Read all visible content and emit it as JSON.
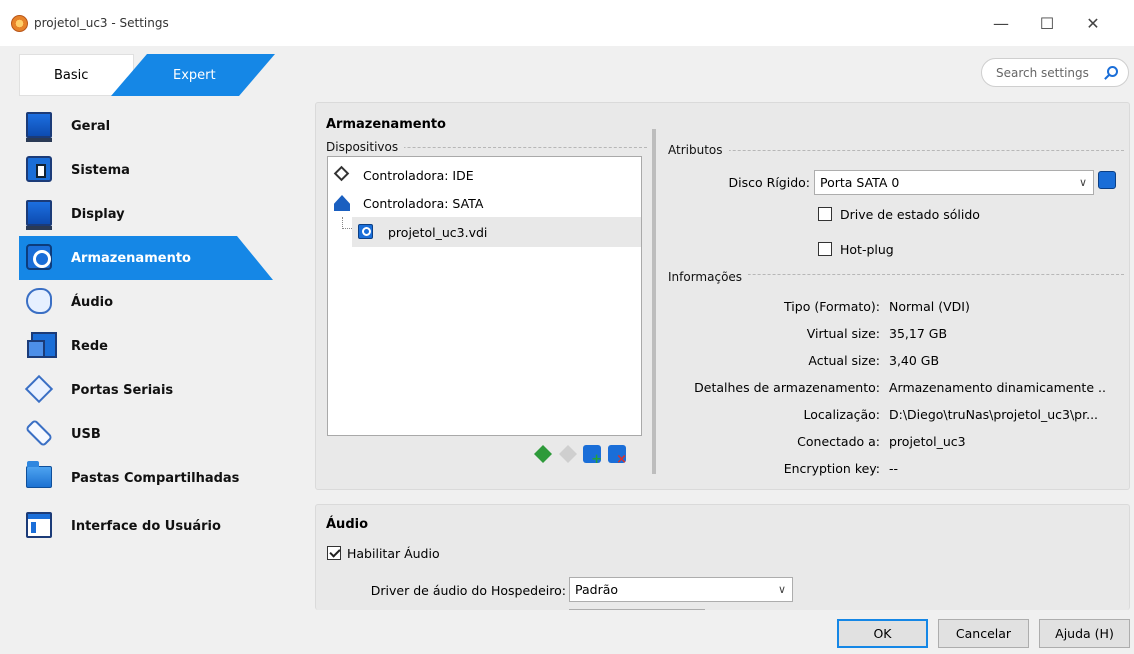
{
  "window": {
    "title": "projetol_uc3 - Settings",
    "minimize": "—",
    "maximize": "☐",
    "close": "✕"
  },
  "mode": {
    "basic": "Basic",
    "expert": "Expert",
    "active": "Expert"
  },
  "search": {
    "placeholder": "Search settings"
  },
  "sidebar": {
    "items": [
      {
        "label": "Geral",
        "icon": "general-icon"
      },
      {
        "label": "Sistema",
        "icon": "system-icon"
      },
      {
        "label": "Display",
        "icon": "display-icon"
      },
      {
        "label": "Armazenamento",
        "icon": "storage-icon",
        "active": true
      },
      {
        "label": "Áudio",
        "icon": "audio-icon"
      },
      {
        "label": "Rede",
        "icon": "network-icon"
      },
      {
        "label": "Portas Seriais",
        "icon": "serial-ports-icon"
      },
      {
        "label": "USB",
        "icon": "usb-icon"
      },
      {
        "label": "Pastas Compartilhadas",
        "icon": "shared-folders-icon"
      },
      {
        "label": "Interface do Usuário",
        "icon": "user-interface-icon"
      }
    ]
  },
  "storage": {
    "title": "Armazenamento",
    "devices_label": "Dispositivos",
    "tree": [
      {
        "label": "Controladora: IDE",
        "icon": "ide-controller-icon"
      },
      {
        "label": "Controladora: SATA",
        "icon": "sata-controller-icon"
      },
      {
        "label": "projetol_uc3.vdi",
        "icon": "hard-disk-icon",
        "selected": true
      }
    ],
    "attributes": {
      "label": "Atributos",
      "hard_disk_label": "Disco Rígido:",
      "hard_disk_value": "Porta SATA 0",
      "ssd_label": "Drive de estado sólido",
      "ssd_checked": false,
      "hotplug_label": "Hot-plug",
      "hotplug_checked": false
    },
    "information": {
      "label": "Informações",
      "rows": [
        {
          "key": "Tipo (Formato):",
          "value": "Normal (VDI)"
        },
        {
          "key": "Virtual size:",
          "value": "35,17 GB"
        },
        {
          "key": "Actual size:",
          "value": "3,40 GB"
        },
        {
          "key": "Detalhes de armazenamento:",
          "value": "Armazenamento dinamicamente .."
        },
        {
          "key": "Localização:",
          "value": "D:\\Diego\\truNas\\projetol_uc3\\pr..."
        },
        {
          "key": "Conectado a:",
          "value": "projetol_uc3"
        },
        {
          "key": "Encryption key:",
          "value": "--"
        }
      ]
    }
  },
  "audio": {
    "title": "Áudio",
    "enable_label": "Habilitar Áudio",
    "enable_checked": true,
    "host_driver_label": "Driver de áudio do Hospedeiro:",
    "host_driver_value": "Padrão"
  },
  "footer": {
    "ok": "OK",
    "cancel": "Cancelar",
    "help": "Ajuda (H)"
  },
  "colors": {
    "accent": "#1587e6"
  }
}
